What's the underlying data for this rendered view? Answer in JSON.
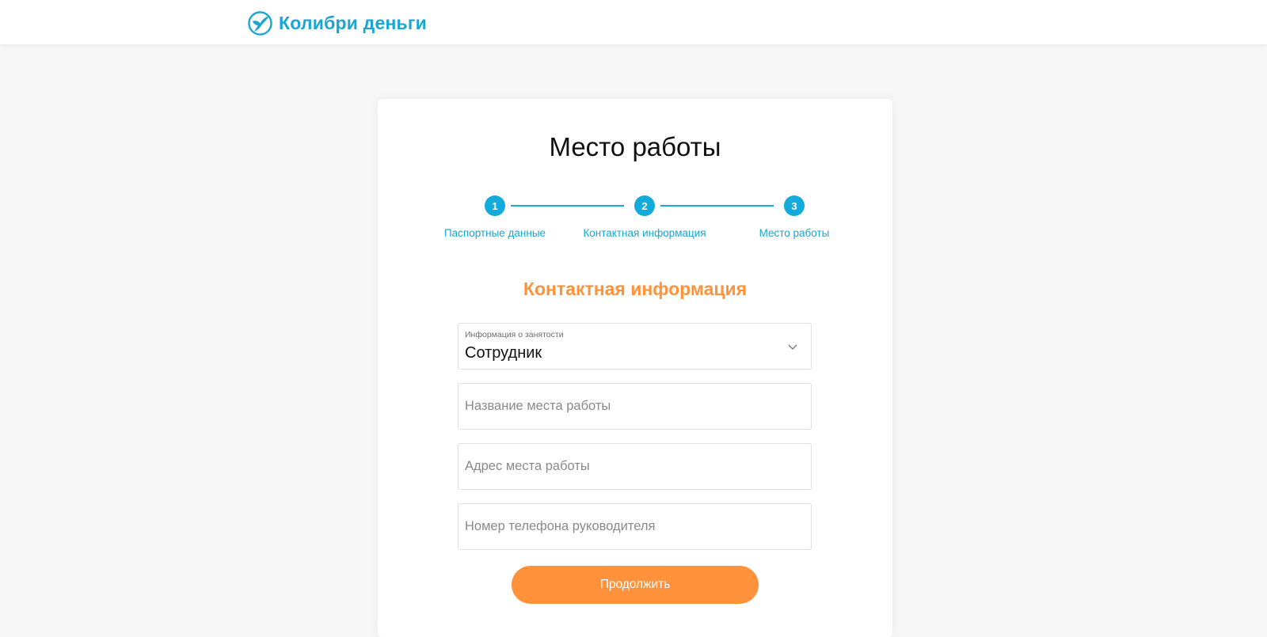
{
  "header": {
    "logo_text": "Колибри деньги",
    "logo_icon": "hummingbird-icon"
  },
  "page": {
    "title": "Место работы",
    "section_title": "Контактная информация"
  },
  "steps": [
    {
      "number": "1",
      "label": "Паспортные данные"
    },
    {
      "number": "2",
      "label": "Контактная информация"
    },
    {
      "number": "3",
      "label": "Место работы"
    }
  ],
  "form": {
    "employment": {
      "label": "Информация о занятости",
      "value": "Сотрудник"
    },
    "workplace_name": {
      "placeholder": "Название места работы",
      "value": ""
    },
    "workplace_address": {
      "placeholder": "Адрес места работы",
      "value": ""
    },
    "manager_phone": {
      "placeholder": "Номер телефона руководителя",
      "value": ""
    },
    "submit_label": "Продолжить"
  },
  "colors": {
    "brand_blue": "#12abdb",
    "accent_orange": "#ff923a",
    "background": "#f7f7f7"
  }
}
